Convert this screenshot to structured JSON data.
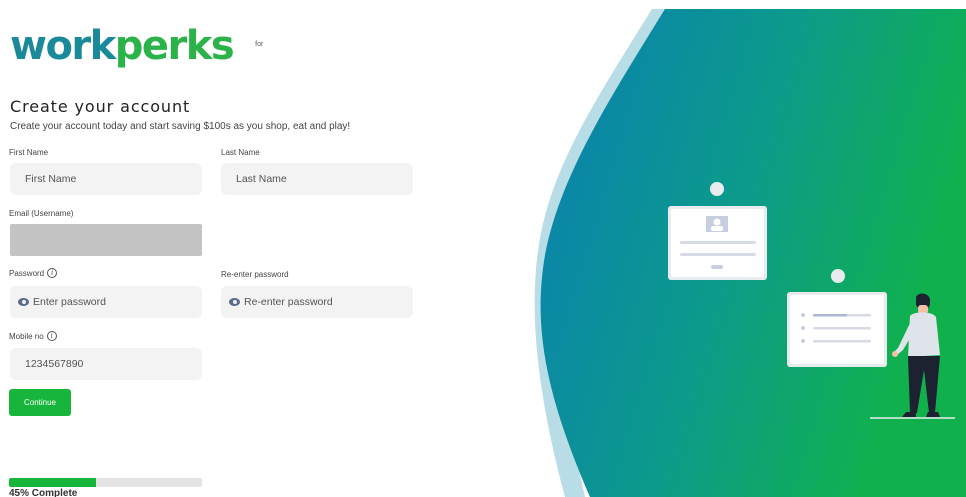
{
  "brand": {
    "part1": "work",
    "part2": "perks",
    "for_text": "for"
  },
  "header": {
    "title": "Create your account",
    "subtitle": "Create your account today and start saving $100s as you shop, eat and play!"
  },
  "form": {
    "first_name": {
      "label": "First Name",
      "placeholder": "First Name"
    },
    "last_name": {
      "label": "Last Name",
      "placeholder": "Last Name"
    },
    "email": {
      "label": "Email (Username)"
    },
    "password": {
      "label": "Password",
      "placeholder": "Enter password"
    },
    "reenter_password": {
      "label": "Re-enter password",
      "placeholder": "Re-enter password"
    },
    "mobile": {
      "label": "Mobile no",
      "placeholder": "1234567890"
    },
    "info_glyph": "i",
    "continue_label": "Continue"
  },
  "progress": {
    "percent": 45,
    "label": "45% Complete"
  },
  "colors": {
    "accent": "#17b53b",
    "teal": "#0f8fa8",
    "green": "#14b04a"
  },
  "icons": [
    "eye-icon",
    "info-icon",
    "id-card-icon",
    "document-card-icon",
    "person-illustration"
  ]
}
